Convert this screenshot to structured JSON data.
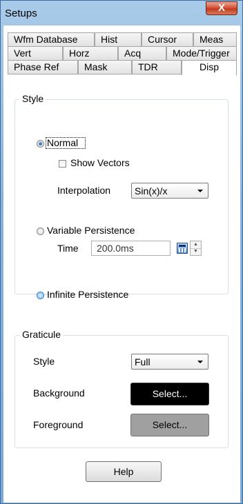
{
  "window": {
    "title": "Setups",
    "close_glyph": "X"
  },
  "tabs": {
    "row1": [
      "Wfm Database",
      "Hist",
      "Cursor",
      "Meas"
    ],
    "row2": [
      "Vert",
      "Horz",
      "Acq",
      "Mode/Trigger"
    ],
    "row3": [
      "Phase Ref",
      "Mask",
      "TDR",
      "Disp"
    ],
    "active": "Disp"
  },
  "style_group": {
    "legend": "Style",
    "normal_label": "Normal",
    "normal_selected": true,
    "show_vectors_label": "Show Vectors",
    "show_vectors_checked": false,
    "interpolation_label": "Interpolation",
    "interpolation_value": "Sin(x)/x",
    "variable_persistence_label": "Variable Persistence",
    "time_label": "Time",
    "time_value": "200.0ms",
    "infinite_persistence_label": "Infinite Persistence"
  },
  "graticule_group": {
    "legend": "Graticule",
    "style_label": "Style",
    "style_value": "Full",
    "background_label": "Background",
    "background_button": "Select...",
    "background_color": "#000000",
    "foreground_label": "Foreground",
    "foreground_button": "Select...",
    "foreground_color": "#a0a0a0"
  },
  "help_button": "Help",
  "icons": {
    "calculator": "calculator-icon",
    "spin_up": "▲",
    "spin_down": "▼"
  },
  "colors": {
    "title_bar": "#86b3de",
    "close_button": "#c23b1f",
    "selected_radio": "#1a4d8c"
  }
}
